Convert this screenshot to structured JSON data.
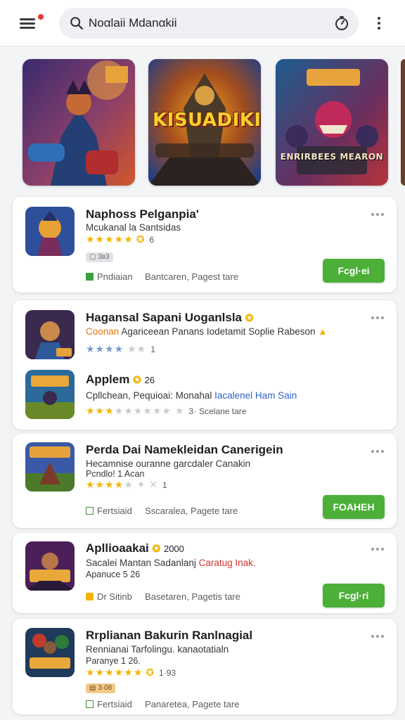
{
  "search": {
    "value": "Nοαlaii Mdanαkii"
  },
  "banners": [
    {
      "title": "",
      "colors": [
        "#3a2a6e",
        "#d4572a"
      ]
    },
    {
      "title": "KISUADIKI",
      "colors": [
        "#1b3d8a",
        "#f0a020"
      ]
    },
    {
      "title": "ENRIRBEES MEARON",
      "colors": [
        "#1d5d8e",
        "#b8343a"
      ]
    }
  ],
  "cards": [
    {
      "name": "Naphoss Pelganpia'",
      "subtitle": "Mcukanal la Santsidas",
      "rating_text": "6",
      "stars": 5,
      "tag": "▢ 3ʙ3",
      "meta_left": "Pndiaian",
      "meta_right": "Bantcaren, Pagest tare",
      "button": "Fcgl·ei"
    },
    {
      "name": "Hagansal Sapani Uoganlsla",
      "subtitle_a": "Coonan",
      "subtitle_b": "Agariceean Panans Iodetamit Soplie Rabeson",
      "rating_text": "1",
      "stars": 5
    },
    {
      "name": "Applem",
      "name_suffix": "26",
      "subtitle_a": "Cpllchean, Pequioai: Monahal",
      "subtitle_b": "Iacalenel Ham Sain",
      "rating_text": "3·",
      "meta_right": "Scelane tare",
      "stars": 3
    },
    {
      "name": "Perda Dai Namekleidan Canerigein",
      "subtitle": "Hecamnise ouranne garcdaler Canakin",
      "subtitle2": "Pcndlo! 1 Acan",
      "rating_text": "1",
      "stars": 4,
      "meta_left": "Fertsiaid",
      "meta_right": "Sscaralea, Pagete tare",
      "button": "FOAHEH"
    },
    {
      "name": "Apllioaakai",
      "name_suffix": "2000",
      "subtitle_a": "Sacalei Mantan Sadanlanj",
      "subtitle_b": "Caratug Inak.",
      "subtitle2": "Apanuce 5 26",
      "meta_left": "Dr Sitinb",
      "meta_right": "Basetaren, Pagetis tare",
      "button": "Fcgl·ri"
    },
    {
      "name": "Rrplianan Bakurin Ranlnagial",
      "subtitle": "Rennianai Tarfolingu. kanaotatialn",
      "subtitle2": "Paranye 1 26.",
      "rating_text": "1·93",
      "stars": 5,
      "tag": "▤ 3·08",
      "meta_left": "Fertsiaid",
      "meta_right": "Panaretea, Pagete tare"
    }
  ],
  "colors": {
    "accent_green": "#4caf38",
    "star_gold": "#f4b400",
    "link_blue": "#2f63c9"
  }
}
